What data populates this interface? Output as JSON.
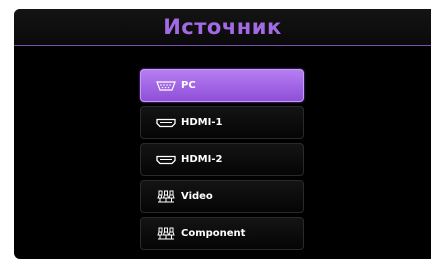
{
  "header": {
    "title": "Источник"
  },
  "colors": {
    "accent": "#a26ae4",
    "selected_bg": "#9f5ee6",
    "panel_bg": "#000000",
    "text": "#ffffff"
  },
  "sources": [
    {
      "label": "PC",
      "icon": "vga-port-icon",
      "selected": true
    },
    {
      "label": "HDMI-1",
      "icon": "hdmi-port-icon",
      "selected": false
    },
    {
      "label": "HDMI-2",
      "icon": "hdmi-port-icon",
      "selected": false
    },
    {
      "label": "Video",
      "icon": "composite-video-icon",
      "selected": false
    },
    {
      "label": "Component",
      "icon": "component-video-icon",
      "selected": false
    }
  ]
}
